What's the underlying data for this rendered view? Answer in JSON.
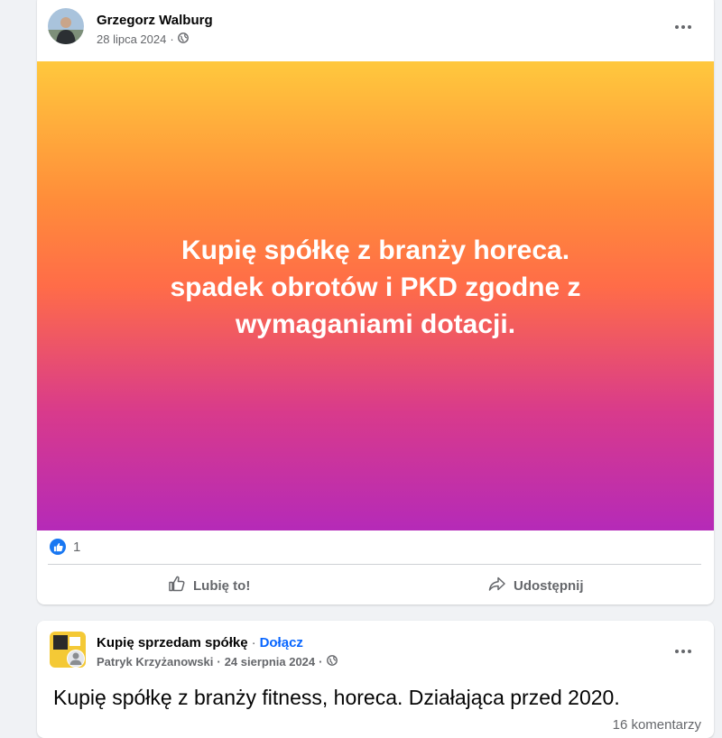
{
  "post1": {
    "author": "Grzegorz Walburg",
    "date": "28 lipca 2024",
    "separator": "·",
    "banner_text_line1": "Kupię spółkę z branży horeca.",
    "banner_text_line2": "spadek obrotów i PKD zgodne z",
    "banner_text_line3": "wymaganiami dotacji.",
    "reaction_count": "1",
    "like_label": "Lubię to!",
    "share_label": "Udostępnij"
  },
  "post2": {
    "group_name": "Kupię sprzedam spółkę",
    "separator": "·",
    "join_label": "Dołącz",
    "author": "Patryk Krzyżanowski",
    "date": "24 sierpnia 2024",
    "text": "Kupię spółkę z branży fitness, horeca. Działająca przed 2020.",
    "comments": "16 komentarzy"
  },
  "colors": {
    "accent": "#0866ff",
    "like_blue": "#1877f2",
    "gradient_top": "#ffc83d",
    "gradient_mid": "#ff6c48",
    "gradient_bottom": "#b52ab8"
  },
  "icons": {
    "privacy": "globe-icon",
    "more": "more-options-icon",
    "like": "thumbs-up-icon",
    "share": "share-arrow-icon"
  }
}
